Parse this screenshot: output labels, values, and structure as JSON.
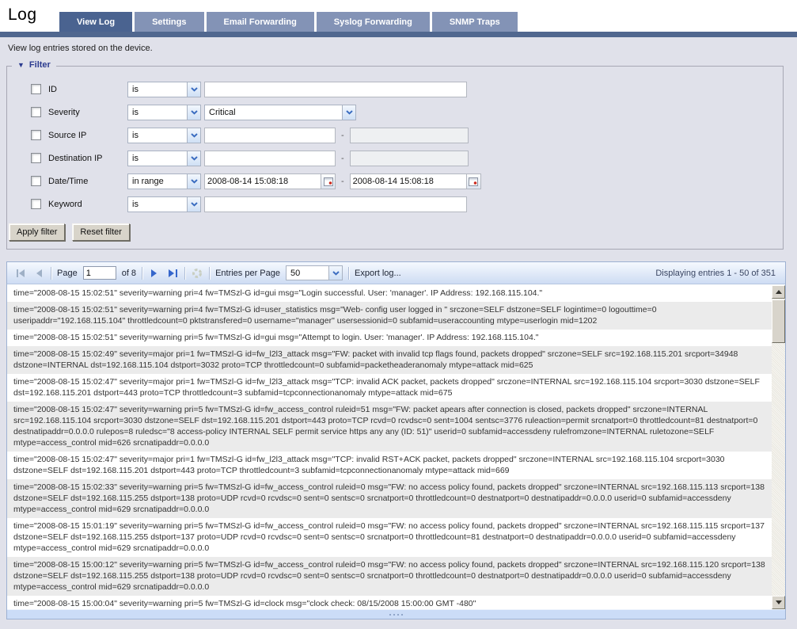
{
  "page": {
    "title": "Log",
    "description": "View log entries stored on the device."
  },
  "tabs": [
    {
      "label": "View Log",
      "active": true
    },
    {
      "label": "Settings",
      "active": false
    },
    {
      "label": "Email Forwarding",
      "active": false
    },
    {
      "label": "Syslog Forwarding",
      "active": false
    },
    {
      "label": "SNMP Traps",
      "active": false
    }
  ],
  "filter": {
    "legend": "Filter",
    "range_separator": "-",
    "apply_label": "Apply filter",
    "reset_label": "Reset filter",
    "rows": [
      {
        "label": "ID",
        "op": "is",
        "type": "text",
        "checked": false,
        "value": ""
      },
      {
        "label": "Severity",
        "op": "is",
        "type": "select",
        "checked": false,
        "value": "Critical"
      },
      {
        "label": "Source IP",
        "op": "is",
        "type": "range",
        "checked": false,
        "value": "",
        "value2": ""
      },
      {
        "label": "Destination IP",
        "op": "is",
        "type": "range",
        "checked": false,
        "value": "",
        "value2": ""
      },
      {
        "label": "Date/Time",
        "op": "in range",
        "type": "daterange",
        "checked": false,
        "value": "2008-08-14 15:08:18",
        "value2": "2008-08-14 15:08:18"
      },
      {
        "label": "Keyword",
        "op": "is",
        "type": "text",
        "checked": false,
        "value": ""
      }
    ]
  },
  "toolbar": {
    "page_label": "Page",
    "page_value": "1",
    "of_label": "of 8",
    "entries_label": "Entries per Page",
    "entries_value": "50",
    "export_label": "Export log...",
    "status": "Displaying entries 1 - 50 of 351"
  },
  "log": {
    "entries": [
      "time=\"2008-08-15 15:02:51\" severity=warning pri=4 fw=TMSzl-G id=gui msg=\"Login successful. User: 'manager'. IP Address: 192.168.115.104.\"",
      "time=\"2008-08-15 15:02:51\" severity=warning pri=4 fw=TMSzl-G id=user_statistics msg=\"Web- config user logged in \" srczone=SELF dstzone=SELF logintime=0 logouttime=0 useripaddr=\"192.168.115.104\" throttledcount=0 pktstransfered=0 username=\"manager\" usersessionid=0 subfamid=useraccounting mtype=userlogin mid=1202",
      "time=\"2008-08-15 15:02:51\" severity=warning pri=5 fw=TMSzl-G id=gui msg=\"Attempt to login. User: 'manager'. IP Address: 192.168.115.104.\"",
      "time=\"2008-08-15 15:02:49\" severity=major pri=1 fw=TMSzl-G id=fw_l2l3_attack msg=\"FW: packet with invalid tcp flags found, packets dropped\" srczone=SELF src=192.168.115.201 srcport=34948 dstzone=INTERNAL dst=192.168.115.104 dstport=3032 proto=TCP throttledcount=0 subfamid=packetheaderanomaly mtype=attack mid=625",
      "time=\"2008-08-15 15:02:47\" severity=major pri=1 fw=TMSzl-G id=fw_l2l3_attack msg=\"TCP: invalid ACK packet, packets dropped\" srczone=INTERNAL src=192.168.115.104 srcport=3030 dstzone=SELF dst=192.168.115.201 dstport=443 proto=TCP throttledcount=3 subfamid=tcpconnectionanomaly mtype=attack mid=675",
      "time=\"2008-08-15 15:02:47\" severity=warning pri=5 fw=TMSzl-G id=fw_access_control ruleid=51 msg=\"FW: packet apears after connection is closed, packets dropped\" srczone=INTERNAL src=192.168.115.104 srcport=3030 dstzone=SELF dst=192.168.115.201 dstport=443 proto=TCP rcvd=0 rcvdsc=0 sent=1004 sentsc=3776 ruleaction=permit srcnatport=0 throttledcount=81 destnatport=0 destnatipaddr=0.0.0.0 rulepos=8 ruledsc=\"8 access-policy INTERNAL SELF permit service https any any (ID: 51)\" userid=0 subfamid=accessdeny rulefromzone=INTERNAL ruletozone=SELF mtype=access_control mid=626 srcnatipaddr=0.0.0.0",
      "time=\"2008-08-15 15:02:47\" severity=major pri=1 fw=TMSzl-G id=fw_l2l3_attack msg=\"TCP: invalid RST+ACK packet, packets dropped\" srczone=INTERNAL src=192.168.115.104 srcport=3030 dstzone=SELF dst=192.168.115.201 dstport=443 proto=TCP throttledcount=3 subfamid=tcpconnectionanomaly mtype=attack mid=669",
      "time=\"2008-08-15 15:02:33\" severity=warning pri=5 fw=TMSzl-G id=fw_access_control ruleid=0 msg=\"FW: no access policy found, packets dropped\" srczone=INTERNAL src=192.168.115.113 srcport=138 dstzone=SELF dst=192.168.115.255 dstport=138 proto=UDP rcvd=0 rcvdsc=0 sent=0 sentsc=0 srcnatport=0 throttledcount=0 destnatport=0 destnatipaddr=0.0.0.0 userid=0 subfamid=accessdeny mtype=access_control mid=629 srcnatipaddr=0.0.0.0",
      "time=\"2008-08-15 15:01:19\" severity=warning pri=5 fw=TMSzl-G id=fw_access_control ruleid=0 msg=\"FW: no access policy found, packets dropped\" srczone=INTERNAL src=192.168.115.115 srcport=137 dstzone=SELF dst=192.168.115.255 dstport=137 proto=UDP rcvd=0 rcvdsc=0 sent=0 sentsc=0 srcnatport=0 throttledcount=81 destnatport=0 destnatipaddr=0.0.0.0 userid=0 subfamid=accessdeny mtype=access_control mid=629 srcnatipaddr=0.0.0.0",
      "time=\"2008-08-15 15:00:12\" severity=warning pri=5 fw=TMSzl-G id=fw_access_control ruleid=0 msg=\"FW: no access policy found, packets dropped\" srczone=INTERNAL src=192.168.115.120 srcport=138 dstzone=SELF dst=192.168.115.255 dstport=138 proto=UDP rcvd=0 rcvdsc=0 sent=0 sentsc=0 srcnatport=0 throttledcount=0 destnatport=0 destnatipaddr=0.0.0.0 userid=0 subfamid=accessdeny mtype=access_control mid=629 srcnatipaddr=0.0.0.0",
      "time=\"2008-08-15 15:00:04\" severity=warning pri=5 fw=TMSzl-G id=clock msg=\"clock check: 08/15/2008 15:00:00 GMT -480\""
    ]
  },
  "icons": {
    "filter_collapse": "▼",
    "combo_chevron": "v",
    "calendar": "calendar",
    "first_page": "|◀",
    "prev_page": "◀",
    "next_page": "▶",
    "last_page": "▶|",
    "refresh": "⟳",
    "scroll_up": "▲",
    "scroll_down": "▼"
  },
  "colors": {
    "tab_active_bg": "#4a6390",
    "tab_inactive_bg": "#8393b6",
    "tab_bar": "#50678f",
    "content_bg": "#e0e1ea",
    "legend_text": "#2b3b8f",
    "toolbar_top": "#f5f9fe",
    "toolbar_bottom": "#cedcf3",
    "row_alt_bg": "#ebebeb",
    "arrow_enabled": "#3566cb",
    "arrow_disabled": "#9fb0c6"
  }
}
